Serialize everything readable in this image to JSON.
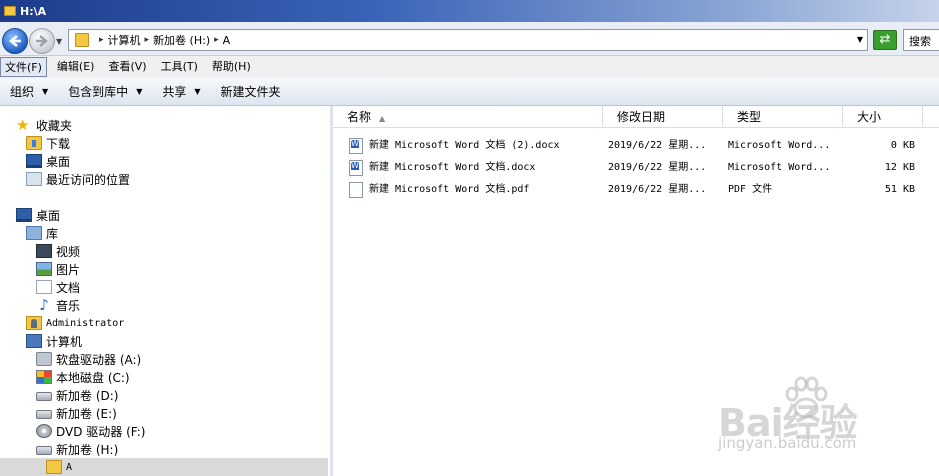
{
  "window": {
    "title": "H:\\A"
  },
  "address": {
    "crumbs": [
      "计算机",
      "新加卷 (H:)",
      "A"
    ],
    "search_placeholder": "搜索"
  },
  "menu": [
    "文件(F)",
    "编辑(E)",
    "查看(V)",
    "工具(T)",
    "帮助(H)"
  ],
  "toolbar": {
    "organize": "组织",
    "include_in_library": "包含到库中",
    "share": "共享",
    "new_folder": "新建文件夹"
  },
  "nav": {
    "favorites": "收藏夹",
    "downloads": "下载",
    "desktop_fav": "桌面",
    "recent": "最近访问的位置",
    "desktop": "桌面",
    "libraries": "库",
    "videos": "视频",
    "pictures": "图片",
    "documents": "文档",
    "music": "音乐",
    "administrator": "Administrator",
    "computer": "计算机",
    "floppy": "软盘驱动器 (A:)",
    "local_disk": "本地磁盘 (C:)",
    "vol_d": "新加卷 (D:)",
    "vol_e": "新加卷 (E:)",
    "dvd": "DVD 驱动器 (F:)",
    "vol_h": "新加卷 (H:)",
    "folder_a": "A"
  },
  "columns": {
    "name": "名称",
    "date": "修改日期",
    "type": "类型",
    "size": "大小"
  },
  "files": [
    {
      "name": "新建 Microsoft Word 文档 (2).docx",
      "date": "2019/6/22 星期...",
      "type": "Microsoft Word...",
      "size": "0 KB",
      "icon": "word-icon"
    },
    {
      "name": "新建 Microsoft Word 文档.docx",
      "date": "2019/6/22 星期...",
      "type": "Microsoft Word...",
      "size": "12 KB",
      "icon": "word-icon"
    },
    {
      "name": "新建 Microsoft Word 文档.pdf",
      "date": "2019/6/22 星期...",
      "type": "PDF 文件",
      "size": "51 KB",
      "icon": "pdf-icon"
    }
  ],
  "watermark": {
    "main": "Bai经验",
    "sub": "jingyan.baidu.com"
  }
}
